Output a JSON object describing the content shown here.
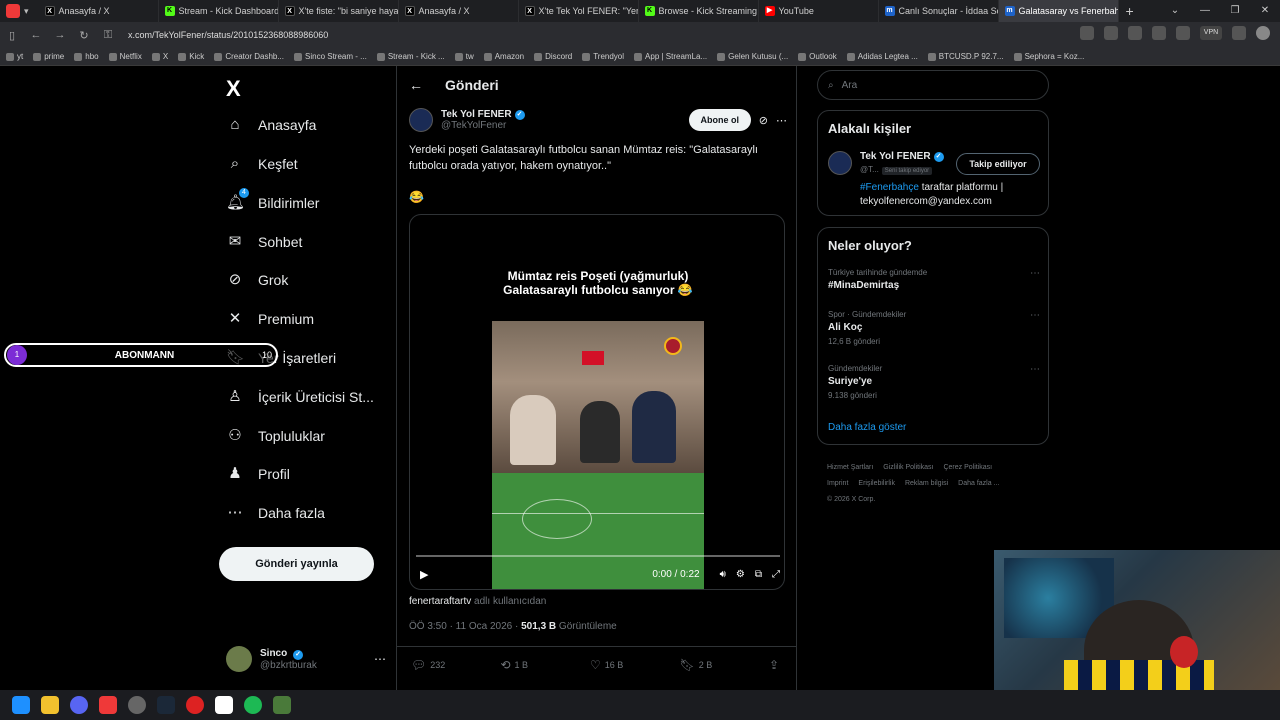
{
  "tabs": [
    {
      "label": "Anasayfa / X",
      "icon": "x"
    },
    {
      "label": "Stream - Kick Dashboard",
      "icon": "k"
    },
    {
      "label": "X'te fiste: \"bi saniye hayali",
      "icon": "x"
    },
    {
      "label": "Anasayfa / X",
      "icon": "x"
    },
    {
      "label": "X'te Tek Yol FENER: \"Yerdeki",
      "icon": "x"
    },
    {
      "label": "Browse - Kick Streaming",
      "icon": "k"
    },
    {
      "label": "YouTube",
      "icon": "yt"
    },
    {
      "label": "Canlı Sonuçlar - İddaa Son",
      "icon": "m"
    },
    {
      "label": "Galatasaray vs Fenerbahçe",
      "icon": "m"
    }
  ],
  "address": {
    "url": "x.com/TekYolFener/status/2010152368088986060",
    "vpn": "VPN"
  },
  "bookmarks": [
    "yt",
    "prime",
    "hbo",
    "Netflix",
    "X",
    "Kick",
    "Creator Dashb...",
    "Sinco Stream - ...",
    "Stream - Kick ...",
    "tw",
    "Amazon",
    "Discord",
    "Trendyol",
    "App | StreamLa...",
    "Gelen Kutusu (...",
    "Outlook",
    "Adidas Legtea ...",
    "BTCUSD.P 92.7...",
    "Sephora = Koz..."
  ],
  "nav": {
    "logo": "X",
    "items": [
      {
        "label": "Anasayfa",
        "icon": "home-icon"
      },
      {
        "label": "Keşfet",
        "icon": "search-icon"
      },
      {
        "label": "Bildirimler",
        "icon": "bell-icon",
        "badge": "4"
      },
      {
        "label": "Sohbet",
        "icon": "mail-icon"
      },
      {
        "label": "Grok",
        "icon": "grok-icon"
      },
      {
        "label": "Premium",
        "icon": "x-icon"
      },
      {
        "label": "Yer İşaretleri",
        "icon": "bookmark-icon"
      },
      {
        "label": "İçerik Üreticisi St...",
        "icon": "creator-icon"
      },
      {
        "label": "Topluluklar",
        "icon": "communities-icon"
      },
      {
        "label": "Profil",
        "icon": "profile-icon"
      },
      {
        "label": "Daha fazla",
        "icon": "more-circle-icon"
      }
    ],
    "post_button": "Gönderi yayınla",
    "account": {
      "name": "Sinco",
      "handle": "@bzkrtburak"
    }
  },
  "overlay": {
    "num": "1",
    "label": "ABONMANN",
    "count": "10"
  },
  "main": {
    "title": "Gönderi",
    "tweet": {
      "name": "Tek Yol FENER",
      "handle": "@TekYolFener",
      "subscribe": "Abone ol",
      "text": "Yerdeki poşeti Galatasaraylı futbolcu sanan Mümtaz reis: \"Galatasaraylı futbolcu orada yatıyor, hakem oynatıyor..\"",
      "emoji": "😂",
      "video_caption": "Mümtaz reis Poşeti (yağmurluk) Galatasaraylı futbolcu sanıyor 😂",
      "video_time": "0:00 / 0:22",
      "source_user": "fenertaraftartv",
      "source_suffix": "adlı kullanıcıdan",
      "time": "ÖÖ 3:50 · 11 Oca 2026 · ",
      "views": "501,3 B",
      "views_label": "Görüntüleme",
      "replies": "232",
      "reposts": "1 B",
      "likes": "16 B",
      "bookmarks": "2 B"
    }
  },
  "right": {
    "search_placeholder": "Ara",
    "related_title": "Alakalı kişiler",
    "related": {
      "name": "Tek Yol FENER",
      "handle": "@T...",
      "follows_you": "Seni takip ediyor",
      "follow_btn": "Takip ediliyor",
      "bio_tag": "#Fenerbahçe",
      "bio_rest": " taraftar platformu | tekyolfenercom@yandex.com"
    },
    "trends_title": "Neler oluyor?",
    "trends": [
      {
        "category": "Türkiye tarihinde gündemde",
        "title": "#MinaDemirtaş",
        "count": ""
      },
      {
        "category": "Spor · Gündemdekiler",
        "title": "Ali Koç",
        "count": "12,6 B gönderi"
      },
      {
        "category": "Gündemdekiler",
        "title": "Suriye'ye",
        "count": "9.138 gönderi"
      }
    ],
    "show_more": "Daha fazla göster",
    "footer": [
      "Hizmet Şartları",
      "Gizlilik Politikası",
      "Çerez Politikası",
      "Imprint",
      "Erişilebilirlik",
      "Reklam bilgisi",
      "Daha fazla ...",
      "© 2026 X Corp."
    ]
  }
}
